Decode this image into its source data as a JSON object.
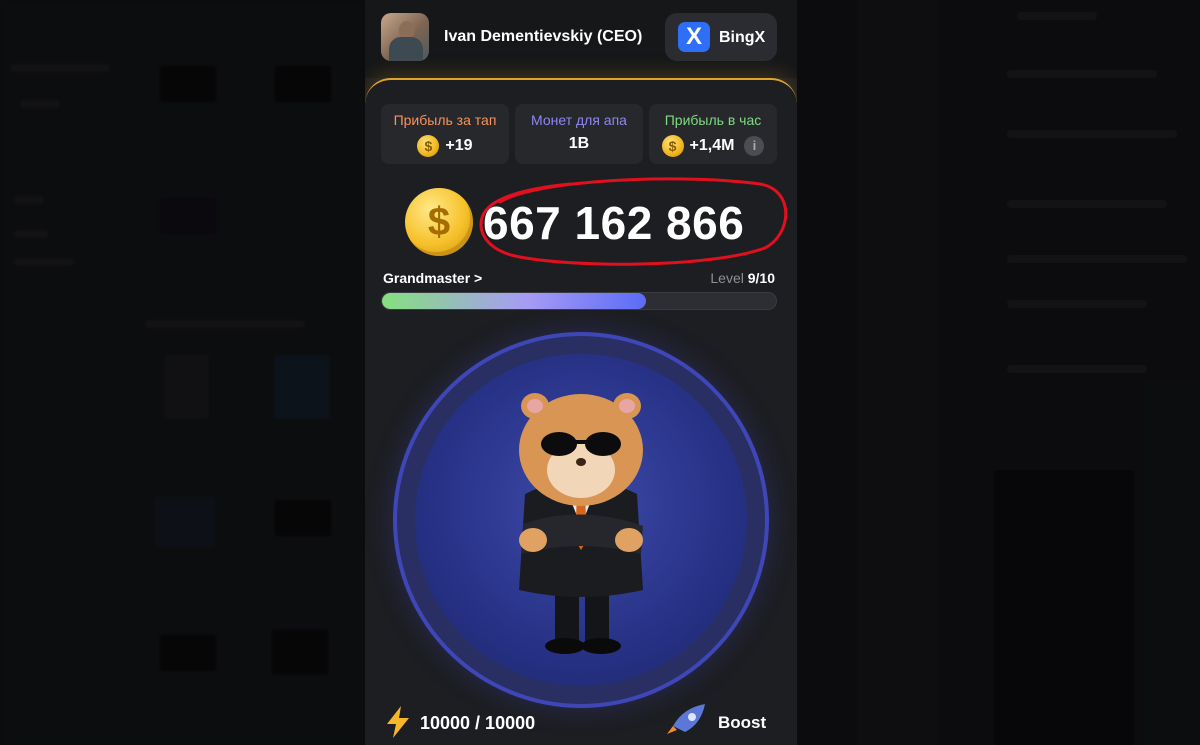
{
  "header": {
    "username": "Ivan Dementievskiy (CEO)",
    "exchange_name": "BingX",
    "exchange_logo": "X"
  },
  "stats": [
    {
      "title": "Прибыль за тап",
      "value": "+19",
      "title_color": "#f7935b",
      "coin": true
    },
    {
      "title": "Монет для апа",
      "value": "1B",
      "title_color": "#8f86f3",
      "coin": false
    },
    {
      "title": "Прибыль в час",
      "value": "+1,4M",
      "title_color": "#7fdb7f",
      "coin": true,
      "info": "i"
    }
  ],
  "balance": "667 162 866",
  "coin_symbol": "$",
  "rank": {
    "name": "Grandmaster",
    "chevron": ">"
  },
  "level": {
    "label": "Level",
    "value": "9/10",
    "progress": 0.67
  },
  "energy": {
    "current_max": "10000 / 10000"
  },
  "boost_label": "Boost",
  "icons": {
    "energy": "lightning-icon",
    "boost": "rocket-icon",
    "info": "info-icon",
    "mascot": "hamster-in-suit"
  },
  "colors": {
    "accent_gold": "#e1a42b",
    "annotation_red": "#e0101e",
    "exchange_blue": "#2f6ef6"
  }
}
